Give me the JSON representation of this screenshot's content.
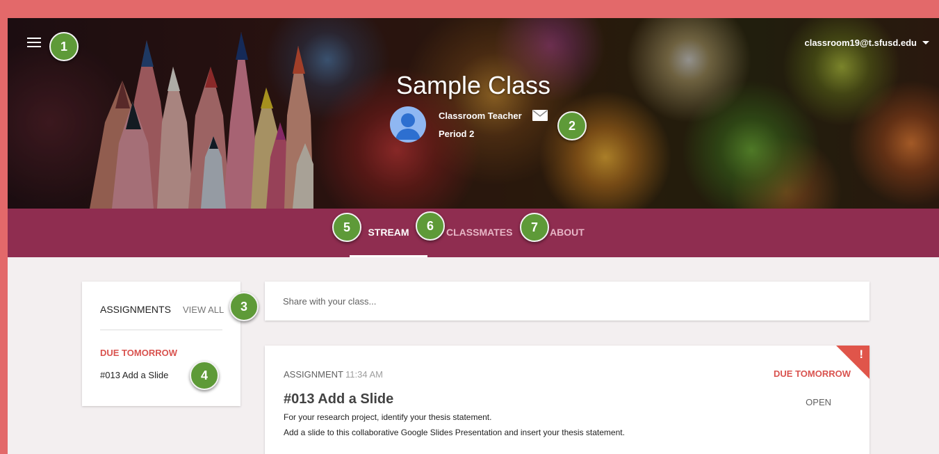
{
  "header": {
    "account_email": "classroom19@t.sfusd.edu",
    "class_title": "Sample Class",
    "teacher_name": "Classroom Teacher",
    "period": "Period 2"
  },
  "icons": {
    "menu": "hamburger-menu-icon",
    "account_dropdown": "caret-down-icon",
    "email": "mail-icon",
    "avatar": "person-avatar-icon",
    "alert": "exclamation-flag-icon"
  },
  "callouts": [
    "1",
    "2",
    "3",
    "4",
    "5",
    "6",
    "7"
  ],
  "tabs": [
    {
      "label": "STREAM",
      "active": true
    },
    {
      "label": "CLASSMATES",
      "active": false
    },
    {
      "label": "ABOUT",
      "active": false
    }
  ],
  "assignments": {
    "title": "ASSIGNMENTS",
    "view_all": "VIEW ALL",
    "due_label": "DUE TOMORROW",
    "items": [
      "#013 Add a Slide"
    ]
  },
  "share": {
    "placeholder": "Share with your class..."
  },
  "post": {
    "type": "ASSIGNMENT",
    "time": "11:34 AM",
    "due": "DUE TOMORROW",
    "flag": "!",
    "title": "#013 Add a Slide",
    "action": "OPEN",
    "line1": "For your research project, identify your thesis statement.",
    "line2": "Add a slide to this collaborative Google Slides Presentation and insert your thesis statement."
  },
  "colors": {
    "frame": "#e3696a",
    "tab_bar": "#8f2d50",
    "callout": "#5e9a38",
    "due_red": "#d9534f",
    "page_bg": "#f3eff0"
  }
}
